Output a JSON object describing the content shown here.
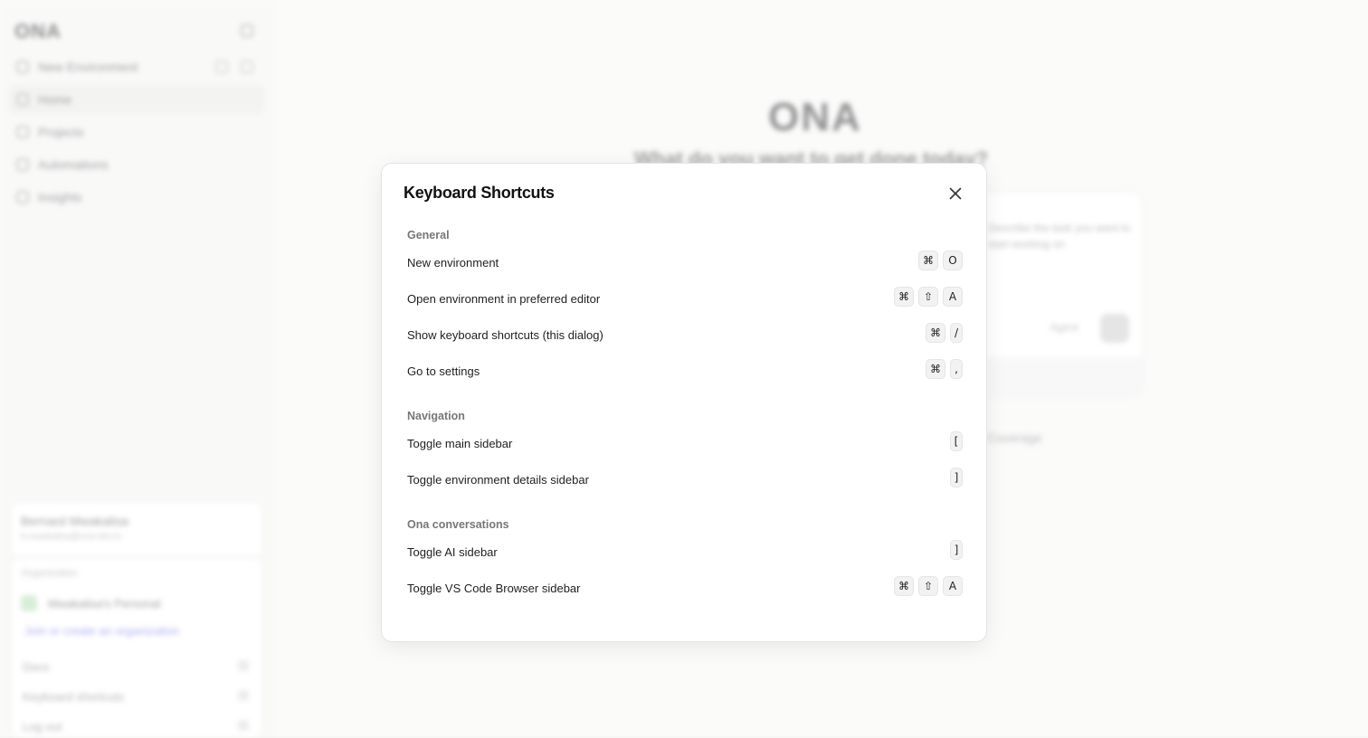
{
  "background": {
    "brand": "ONA",
    "nav": [
      {
        "label": "New Environment",
        "icon": "plus-circle-icon"
      },
      {
        "label": "Home",
        "icon": "home-icon",
        "active": true
      },
      {
        "label": "Projects",
        "icon": "grid-icon"
      },
      {
        "label": "Automations",
        "icon": "gear-icon"
      },
      {
        "label": "Insights",
        "icon": "chart-icon"
      }
    ],
    "user": {
      "name": "Bernard Mwakalisa",
      "email": "b.mwakalisa@ona-dev.io"
    },
    "org": {
      "label": "Organization",
      "name": "Mwakalisa's Personal",
      "join": "Join or create an organization"
    },
    "menu": [
      "Docs",
      "Keyboard shortcuts",
      "Log out"
    ],
    "hero": {
      "logo": "ONA",
      "subtitle": "What do you want to get done today?",
      "prompt_text": "Describe the task you want to start working on",
      "agent": "Agent",
      "link": "Coverage"
    }
  },
  "dialog": {
    "title": "Keyboard Shortcuts",
    "close_icon": "close-icon",
    "sections": [
      {
        "title": "General",
        "shortcuts": [
          {
            "label": "New environment",
            "keys": [
              "⌘",
              "O"
            ]
          },
          {
            "label": "Open environment in preferred editor",
            "keys": [
              "⌘",
              "⇧",
              "A"
            ]
          },
          {
            "label": "Show keyboard shortcuts (this dialog)",
            "keys": [
              "⌘",
              "/"
            ]
          },
          {
            "label": "Go to settings",
            "keys": [
              "⌘",
              ","
            ]
          }
        ]
      },
      {
        "title": "Navigation",
        "shortcuts": [
          {
            "label": "Toggle main sidebar",
            "keys": [
              "["
            ]
          },
          {
            "label": "Toggle environment details sidebar",
            "keys": [
              "]"
            ]
          }
        ]
      },
      {
        "title": "Ona conversations",
        "shortcuts": [
          {
            "label": "Toggle AI sidebar",
            "keys": [
              "]"
            ]
          },
          {
            "label": "Toggle VS Code Browser sidebar",
            "keys": [
              "⌘",
              "⇧",
              "A"
            ]
          }
        ]
      }
    ]
  },
  "colors": {
    "overlay": "#ffffff",
    "dialog_bg": "#ffffff",
    "key_bg": "#f2f2f2",
    "accent_link": "#6b6bea"
  }
}
